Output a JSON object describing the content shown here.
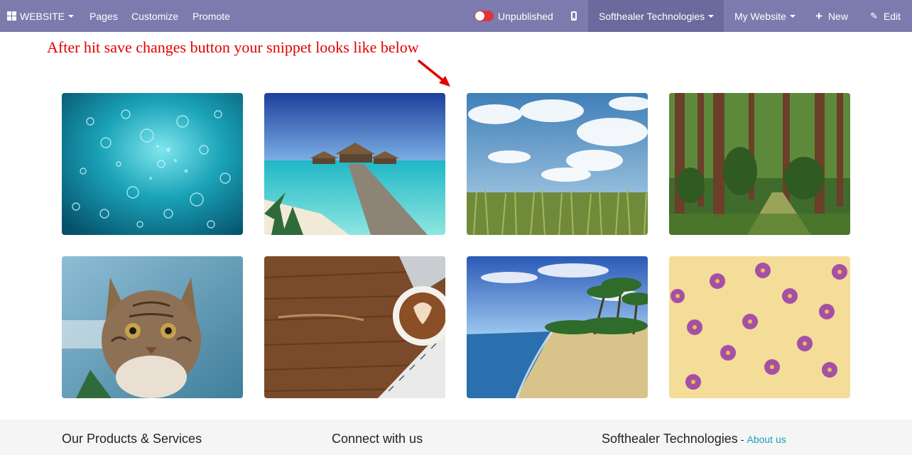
{
  "topbar": {
    "app_menu": {
      "label": "WEBSITE",
      "icon": "apps-grid-icon"
    },
    "menu_items": [
      {
        "label": "Pages"
      },
      {
        "label": "Customize"
      },
      {
        "label": "Promote"
      }
    ],
    "publish_status": "Unpublished",
    "publish_toggle_color": "#e0343c",
    "mobile_preview_icon": "mobile-icon",
    "company_switcher": "Softhealer Technologies",
    "website_switcher": "My Website",
    "new_label": "New",
    "edit_label": "Edit",
    "bar_color": "#7c7bad"
  },
  "annotation": {
    "text": "After hit save changes button your snippet looks like below",
    "color": "#e00000"
  },
  "gallery": {
    "images": [
      {
        "subject": "underwater bubbles"
      },
      {
        "subject": "beach pier huts"
      },
      {
        "subject": "sky over cornfield"
      },
      {
        "subject": "forest trail"
      },
      {
        "subject": "tabby cat"
      },
      {
        "subject": "coffee on wooden desk"
      },
      {
        "subject": "tropical beach palms"
      },
      {
        "subject": "purple flowers on yellow"
      }
    ]
  },
  "footer": {
    "products_heading": "Our Products & Services",
    "connect_heading": "Connect with us",
    "company_heading": "Softhealer Technologies",
    "separator": "-",
    "about_link": "About us"
  }
}
